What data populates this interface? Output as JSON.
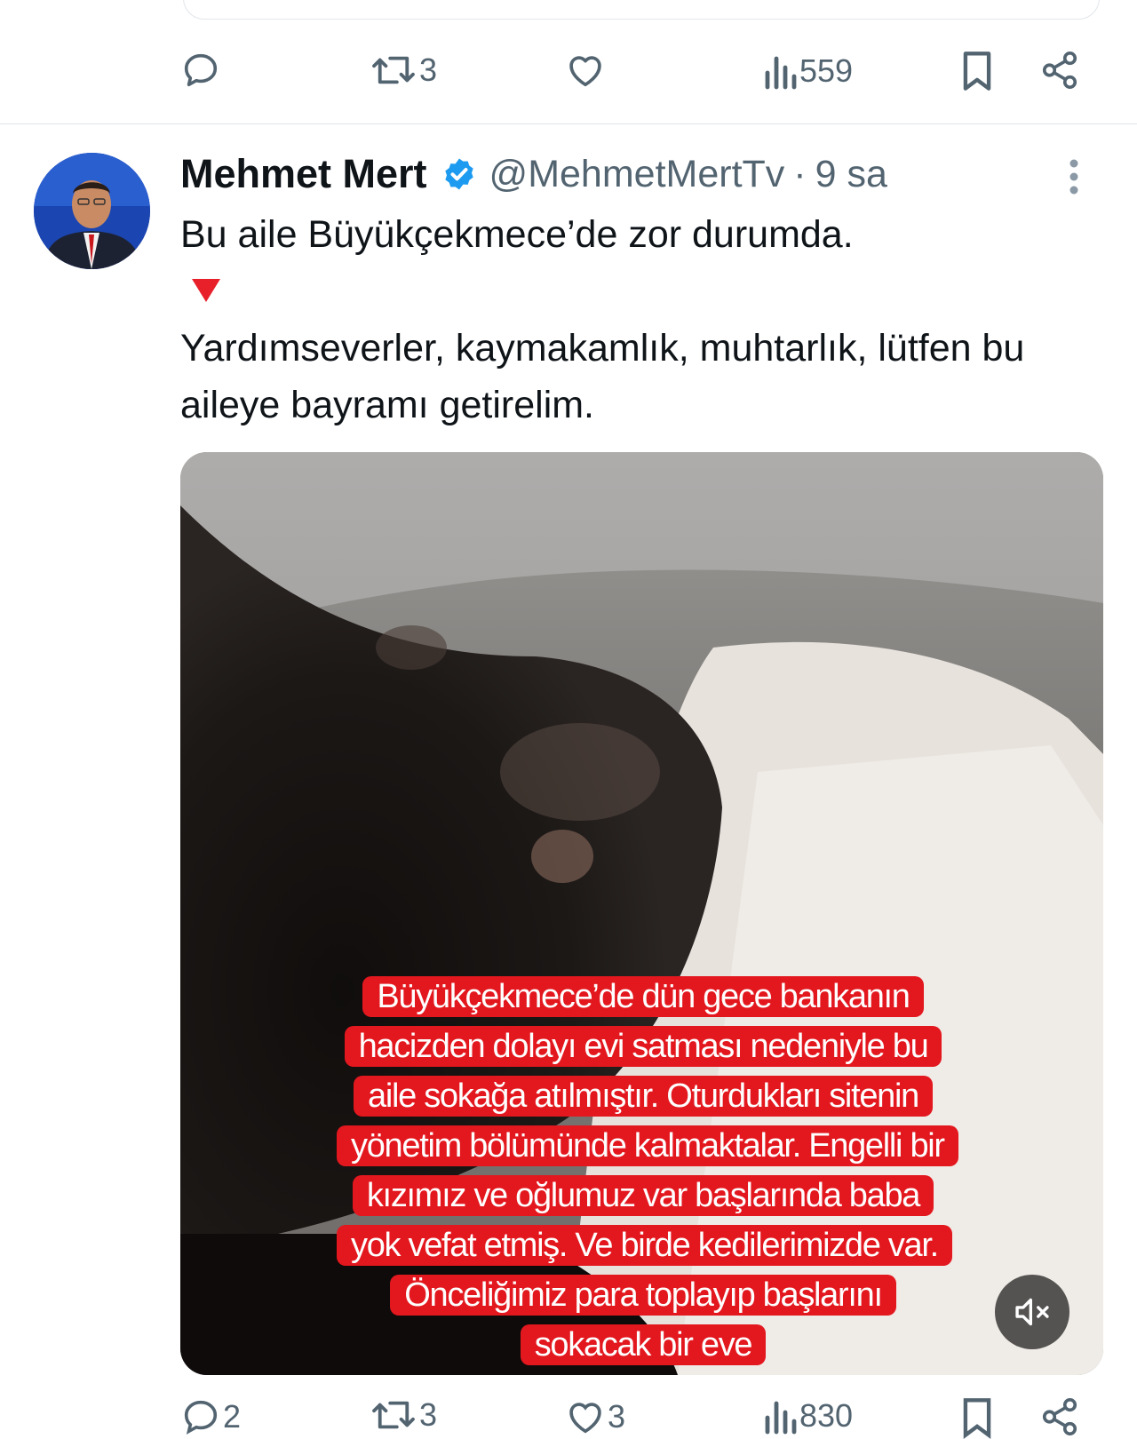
{
  "prev_tweet": {
    "actions": {
      "reply": "",
      "retweet": "3",
      "like": "",
      "views": "559"
    },
    "icons": [
      "reply-icon",
      "retweet-icon",
      "like-icon",
      "views-icon",
      "bookmark-icon",
      "share-icon"
    ]
  },
  "tweet": {
    "author_name": "Mehmet Mert",
    "handle": "@MehmetMertTv",
    "separator": "·",
    "time": "9 sa",
    "text_line1": "Bu aile Büyükçekmece’de zor durumda.",
    "text_line2": "Yardımseverler, kaymakamlık, muhtarlık, lütfen bu aileye bayramı getirelim.",
    "media": {
      "caption": "Büyükçekmece’de dün gece bankanın hacizden dolayı evi satması nedeniyle bu aile sokağa atılmıştır. Oturdukları sitenin yönetim bölümünde kalmaktalar. Engelli bir kızımız  ve oğlumuz var başlarında baba yok vefat etmiş. Ve birde kedilerimizde var. Önceliğimiz para toplayıp başlarını sokacak bir eve"
    },
    "actions": {
      "reply": "2",
      "retweet": "3",
      "like": "3",
      "views": "830"
    }
  },
  "colors": {
    "verified": "#1d9bf0",
    "caption_bg": "#e3171e",
    "icon_gray": "#536471",
    "red_triangle": "#e8202a"
  }
}
